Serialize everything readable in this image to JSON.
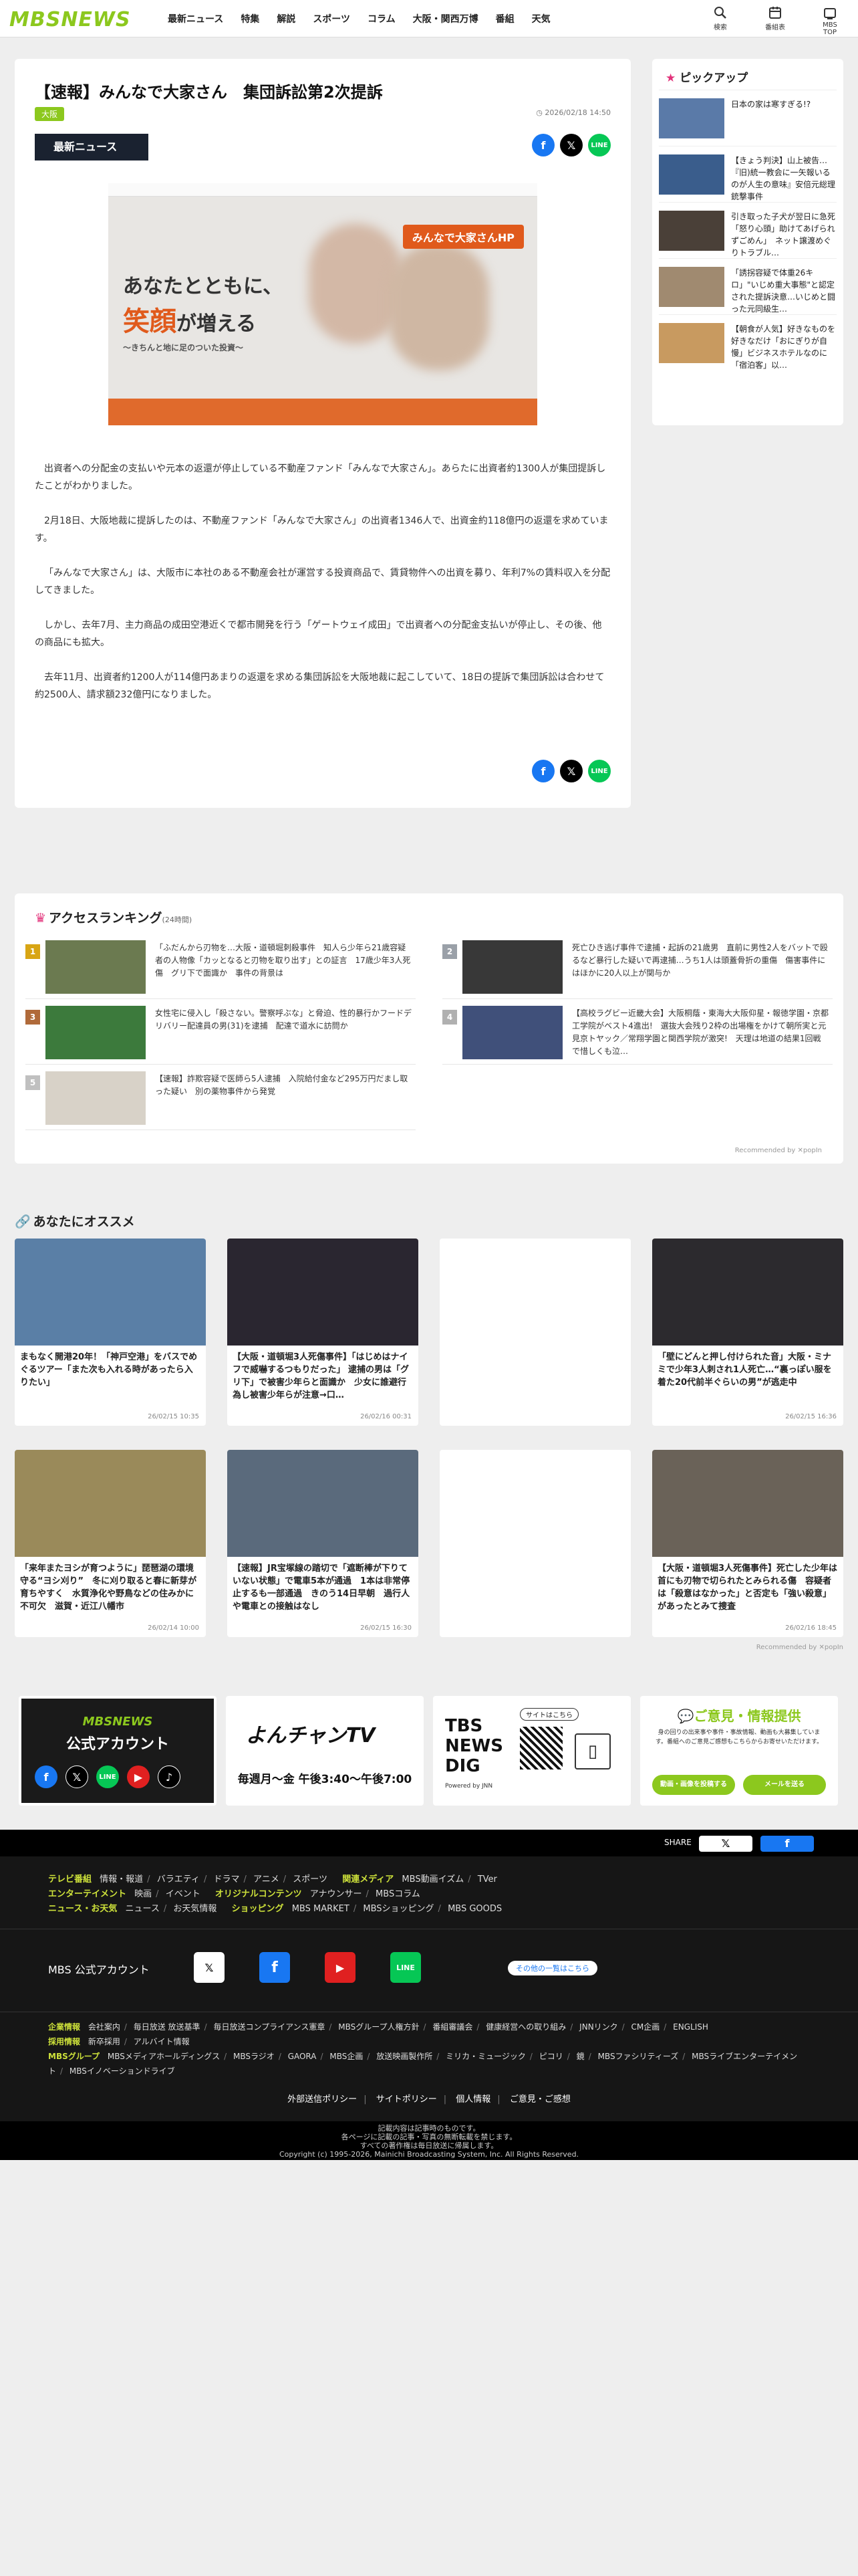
{
  "header": {
    "logo": "MBSNEWS",
    "nav": [
      "最新ニュース",
      "特集",
      "解説",
      "スポーツ",
      "コラム",
      "大阪・関西万博",
      "番組",
      "天気"
    ],
    "icons": [
      {
        "name": "search-icon",
        "label": "検索",
        "glyph": "🔍"
      },
      {
        "name": "program-guide-icon",
        "label": "番組表",
        "glyph": "▦"
      },
      {
        "name": "mbs-top-icon",
        "label": "MBS TOP",
        "glyph": "▢"
      }
    ]
  },
  "article": {
    "title": "【速報】みんなで大家さん　集団訴訟第2次提訴",
    "tag": "大阪",
    "date": "2026/02/18 14:50",
    "latest_label": "最新ニュース",
    "hero": {
      "pill": "みんなで大家さんHP",
      "catch1": "あなたとともに、",
      "catch2": "笑顔",
      "catch3": "が増える",
      "sub": "〜きちんと地に足のついた投資〜"
    },
    "paragraphs": [
      "出資者への分配金の支払いや元本の返還が停止している不動産ファンド「みんなで大家さん」。あらたに出資者約1300人が集団提訴したことがわかりました。",
      "2月18日、大阪地裁に提訴したのは、不動産ファンド「みんなで大家さん」の出資者1346人で、出資金約118億円の返還を求めています。",
      "「みんなで大家さん」は、大阪市に本社のある不動産会社が運営する投資商品で、賃貸物件への出資を募り、年利7%の賃料収入を分配してきました。",
      "しかし、去年7月、主力商品の成田空港近くで都市開発を行う「ゲートウェイ成田」で出資者への分配金支払いが停止し、その後、他の商品にも拡大。",
      "去年11月、出資者約1200人が114億円あまりの返還を求める集団訴訟を大阪地裁に起こしていて、18日の提訴で集団訴訟は合わせて約2500人、請求額232億円になりました。"
    ]
  },
  "pickup": {
    "title": "ピックアップ",
    "items": [
      {
        "text": "日本の家は寒すぎる!?",
        "color": "#5a7aa8"
      },
      {
        "text": "【きょう判決】山上被告…『旧)統一教会に一矢報いるのが人生の意味』安倍元総理銃撃事件",
        "color": "#3a5d8c"
      },
      {
        "text": "引き取った子犬が翌日に急死「怒り心頭」助けてあげられずごめん」　ネット譲渡めぐりトラブル…",
        "color": "#4a4038"
      },
      {
        "text": "「誘拐容疑で体重26キロ」\"いじめ重大事態\"と認定された提訴決意…いじめと闘った元同級生…",
        "color": "#a08a70"
      },
      {
        "text": "【朝食が人気】好きなものを好きなだけ「おにぎりが自慢」ビジネスホテルなのに「宿泊客」以…",
        "color": "#c89a60"
      }
    ]
  },
  "ranking": {
    "title": "アクセスランキング",
    "period": "(24時間)",
    "recommended": "Recommended by ✕popIn",
    "items": [
      {
        "no": "1",
        "rank_color": "#d8a514",
        "text": "「ふだんから刃物を…大阪・道頓堀刺殺事件　知人ら少年ら21歳容疑者の人物像「カッとなると刃物を取り出す」との証言　17歳少年3人死傷　グリ下で面識か　事件の背景は",
        "color": "#6b7a50"
      },
      {
        "no": "2",
        "rank_color": "#9aa0a8",
        "text": "死亡ひき逃げ事件で逮捕・起訴の21歳男　直前に男性2人をバットで殴るなど暴行した疑いで再逮捕…うち1人は頭蓋骨折の重傷　傷害事件にはほかに20人以上が関与か",
        "color": "#383838"
      },
      {
        "no": "3",
        "rank_color": "#b06a3a",
        "text": "女性宅に侵入し「殺さない。警察呼ぶな」と脅迫、性的暴行かフードデリバリー配達員の男(31)を逮捕　配達で道水に訪問か",
        "color": "#3c7a3c"
      },
      {
        "no": "4",
        "rank_color": "#b0b0b0",
        "text": "【高校ラグビー近畿大会】大阪桐蔭・東海大大阪仰星・報徳学園・京都工学院がベスト4進出!　選抜大会残り2枠の出場権をかけて朝所実と元見京トヤック／常翔学園と関西学院が激突!　天理は地道の結果1回戦で惜しくも泣…",
        "color": "#40507a"
      },
      {
        "no": "5",
        "rank_color": "#c0c0c0",
        "text": "【速報】詐欺容疑で医師ら5人逮捕　入院給付金など295万円だまし取った疑い　別の薬物事件から発覚",
        "color": "#d8d2c8"
      }
    ]
  },
  "osusume": {
    "title": "あなたにオススメ",
    "recommended": "Recommended by ✕popIn",
    "cards": [
      {
        "text": "まもなく開港20年！「神戸空港」をバスでめぐるツアー「また次も入れる時があったら入りたい」",
        "date": "26/02/15 10:35",
        "color": "#5a7fa6"
      },
      {
        "text": "【大阪・道頓堀3人死傷事件】「はじめはナイフで威嚇するつもりだった」 逮捕の男は「グリ下」で被害少年らと面識か　少女に誰避行為し被害少年らが注意→口…",
        "date": "26/02/16 00:31",
        "color": "#2a2630"
      },
      {
        "text": "",
        "date": "",
        "color": "#ffffff"
      },
      {
        "text": "「壁にどんと押し付けられた音」大阪・ミナミで少年3人刺され1人死亡…“裏っぽい服を着た20代前半ぐらいの男”が逃走中",
        "date": "26/02/15 16:36",
        "color": "#2c2a2e"
      },
      {
        "text": "「来年またヨシが育つように」琵琶湖の環境守る“ヨシ刈り”　冬に刈り取ると春に新芽が育ちやすく　水質浄化や野鳥などの住みかに不可欠　滋賀・近江八幡市",
        "date": "26/02/14 10:00",
        "color": "#9a8a5a"
      },
      {
        "text": "【速報】JR宝塚線の踏切で「遮断棒が下りていない状態」で電車5本が通過　1本は非常停止するも一部通過　きのう14日早朝　過行人や電車との接触はなし",
        "date": "26/02/15 16:30",
        "color": "#5a6a7c"
      },
      {
        "text": "",
        "date": "",
        "color": "#ffffff"
      },
      {
        "text": "【大阪・道頓堀3人死傷事件】死亡した少年は首にも刃物で切られたとみられる傷　容疑者は「殺意はなかった」と否定も「強い殺意」があったとみて捜査",
        "date": "26/02/16 18:45",
        "color": "#6a6258"
      }
    ]
  },
  "banners": {
    "official": {
      "title": "MBSNEWS",
      "sub": "公式アカウント",
      "bg": "#1a1a1a"
    },
    "yonchan": {
      "title": "よんチャンTV",
      "time": "毎週月〜金 午後3:40〜午後7:00"
    },
    "tbs": {
      "title": "TBS NEWS DIG",
      "powered": "Powered by JNN",
      "pill": "サイトはこちら"
    },
    "opinion": {
      "title": "ご意見・情報提供",
      "desc": "身の回りの出来事や事件・事故情報、動画も大募集しています。番組へのご意見ご感想もこちらからお寄せいただけます。",
      "btn1": "動画・画像を投稿する",
      "btn2": "メールを送る"
    }
  },
  "sharebar": {
    "label": "SHARE",
    "x": "𝕏",
    "fb": "f"
  },
  "footer": {
    "rows": [
      {
        "key": "テレビ番組",
        "items": [
          "情報・報道",
          "バラエティ",
          "ドラマ",
          "アニメ",
          "スポーツ"
        ],
        "key2": "関連メディア",
        "items2": [
          "MBS動画イズム",
          "TVer"
        ]
      },
      {
        "key": "エンターテイメント",
        "items": [
          "映画",
          "イベント"
        ],
        "key2": "オリジナルコンテンツ",
        "items2": [
          "アナウンサー",
          "MBSコラム"
        ]
      },
      {
        "key": "ニュース・お天気",
        "items": [
          "ニュース",
          "お天気情報"
        ],
        "key2": "ショッピング",
        "items2": [
          "MBS MARKET",
          "MBSショッピング",
          "MBS GOODS"
        ]
      }
    ],
    "sns_label": "MBS 公式アカウント",
    "sns_more": "その他の一覧はこちら",
    "corp_rows": [
      {
        "key": "企業情報",
        "items": [
          "会社案内",
          "毎日放送 放送基準",
          "毎日放送コンプライアンス憲章",
          "MBSグループ人権方針",
          "番組審議会",
          "健康経営への取り組み",
          "JNNリンク",
          "CM企画",
          "ENGLISH"
        ]
      },
      {
        "key": "採用情報",
        "items": [
          "新卒採用",
          "アルバイト情報"
        ]
      },
      {
        "key": "MBSグループ",
        "items": [
          "MBSメディアホールディングス",
          "MBSラジオ",
          "GAORA",
          "MBS企画",
          "放送映画製作所",
          "ミリカ・ミュージック",
          "ピコリ",
          "鏡",
          "MBSファシリティーズ",
          "MBSライブエンターテイメント",
          "MBSイノベーションドライブ"
        ]
      }
    ],
    "policies": [
      "外部送信ポリシー",
      "サイトポリシー",
      "個人情報",
      "ご意見・ご感想"
    ],
    "copyright": [
      "記載内容は記事時のものです。",
      "各ページに記載の記事・写真の無断転載を禁じます。",
      "すべての著作権は毎日放送に帰属します。",
      "Copyright (c) 1995-2026, Mainichi Broadcasting System, Inc. All Rights Reserved."
    ]
  }
}
